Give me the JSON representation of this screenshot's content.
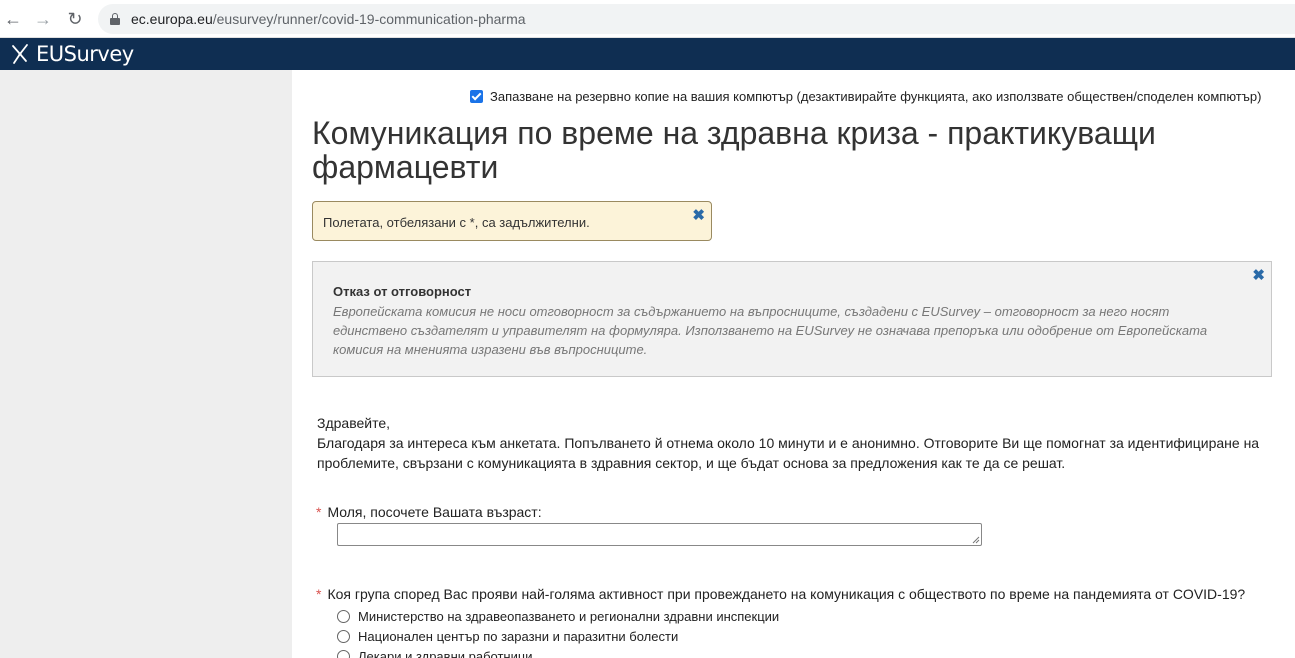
{
  "browser": {
    "url_domain": "ec.europa.eu",
    "url_path": "/eusurvey/runner/covid-19-communication-pharma"
  },
  "header": {
    "logo_text": "EUSurvey",
    "bg_color": "#0f2e52"
  },
  "backup": {
    "checked": true,
    "label": "Запазване на резервно копие на вашия компютър (дезактивирайте функцията, ако използвате обществен/споделен компютър)"
  },
  "survey": {
    "title": "Комуникация по време на здравна криза - практикуващи фармацевти"
  },
  "required_note": {
    "text": "Полетата, отбелязани с *, са задължителни."
  },
  "disclaimer": {
    "title": "Отказ от отговорност",
    "body": "Европейската комисия не носи отговорност за съдържанието на въпросниците, създадени с EUSurvey – отговорност за него носят единствено създателят и управителят на формуляра. Използването на EUSurvey не означава препоръка или одобрение от Европейската комисия на мненията изразени във въпросниците."
  },
  "intro": {
    "greeting": "Здравейте,",
    "text": "Благодаря за интереса към анкетата. Попълването й отнема около 10 минути и е анонимно. Отговорите Ви ще помогнат за идентифициране на проблемите, свързани с комуникацията в здравния сектор, и ще бъдат основа за предложения как те да се решат."
  },
  "questions": {
    "q1": {
      "required_mark": "*",
      "label": "Моля, посочете Вашата възраст:",
      "value": ""
    },
    "q2": {
      "required_mark": "*",
      "label": "Коя група според Вас прояви най-голяма активност при провеждането на комуникация с обществото по време на пандемията от COVID-19?",
      "options": [
        "Министерство на здравеопазването и регионални здравни инспекции",
        "Национален център по заразни и паразитни болести",
        "Лекари и здравни работници"
      ]
    }
  }
}
